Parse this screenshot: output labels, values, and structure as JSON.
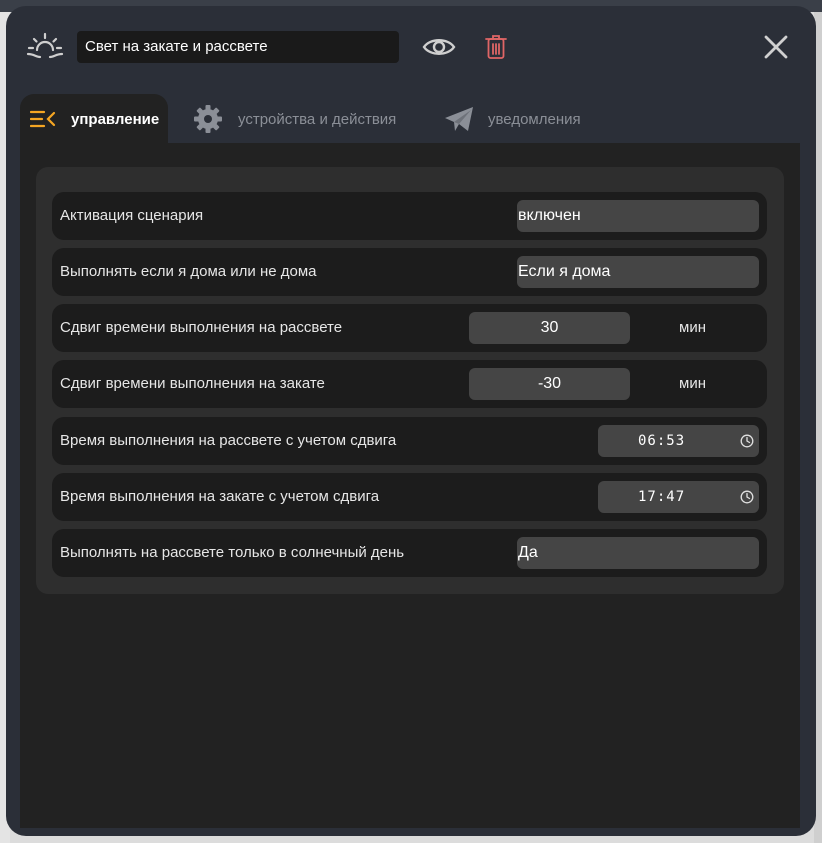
{
  "header": {
    "scene_icon": "sunset-icon",
    "title": "Свет на закате и рассвете",
    "view_icon": "eye-icon",
    "delete_icon": "trash-icon",
    "close_icon": "close-icon"
  },
  "tabs": [
    {
      "label": "управление",
      "icon": "menu-collapse-icon",
      "active": true
    },
    {
      "label": "устройства и действия",
      "icon": "gear-icon",
      "active": false
    },
    {
      "label": "уведомления",
      "icon": "paper-plane-icon",
      "active": false
    }
  ],
  "settings": {
    "activation": {
      "label": "Активация сценария",
      "value": "включен"
    },
    "presence": {
      "label": "Выполнять если я дома или не дома",
      "value": "Если я дома"
    },
    "sunrise_offset": {
      "label": "Сдвиг времени выполнения на рассвете",
      "value": "30",
      "unit": "мин"
    },
    "sunset_offset": {
      "label": "Сдвиг времени выполнения на закате",
      "value": "-30",
      "unit": "мин"
    },
    "sunrise_time": {
      "label": "Время выполнения на рассвете с учетом сдвига",
      "value": "06:53"
    },
    "sunset_time": {
      "label": "Время выполнения на закате с учетом сдвига",
      "value": "17:47"
    },
    "sunny_only": {
      "label": "Выполнять на рассвете только в солнечный день",
      "value": "Да"
    }
  },
  "colors": {
    "accent": "#f5a623",
    "trash": "#e06666",
    "modal_bg": "#2b2f38",
    "content_bg": "#222222",
    "row_bg": "#1c1c1c",
    "field_bg": "#454545"
  }
}
